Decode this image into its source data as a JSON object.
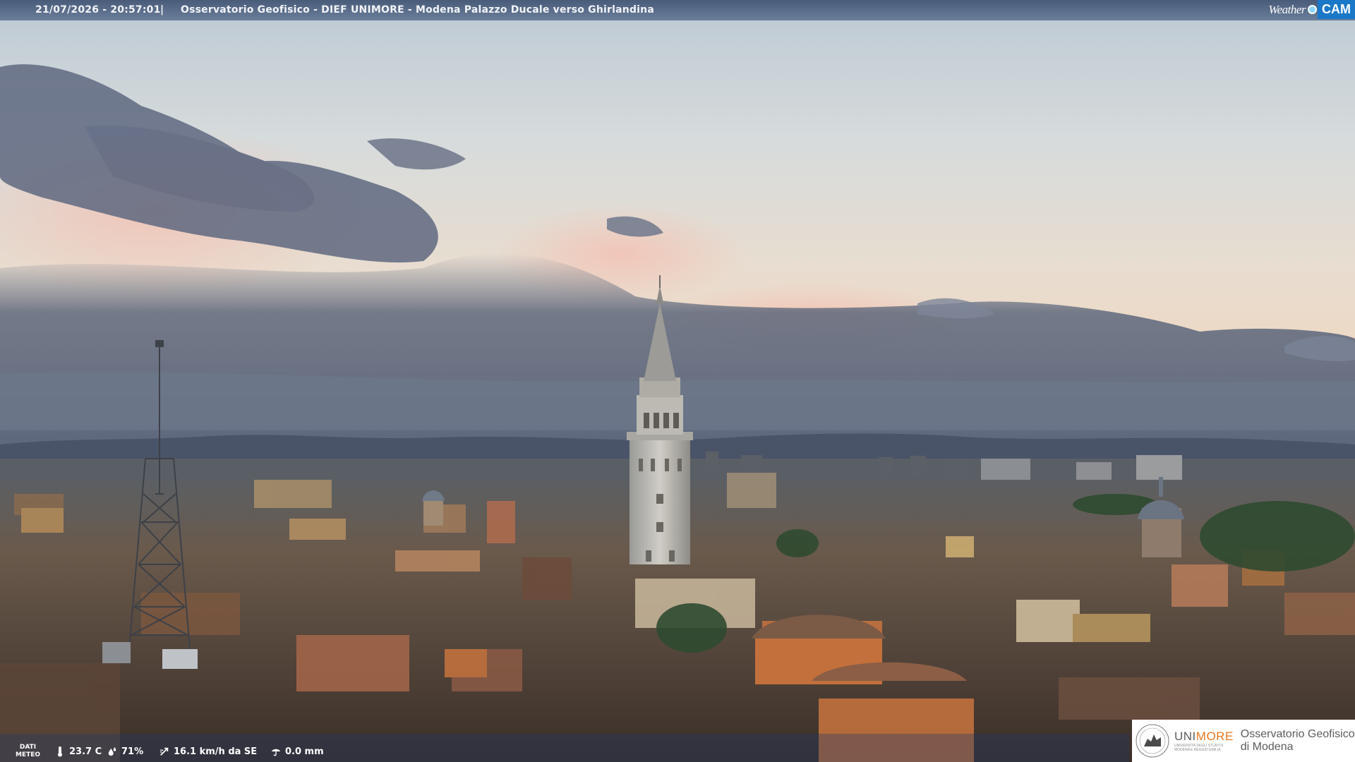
{
  "header": {
    "datetime": "21/07/2026 - 20:57:01",
    "separator": "|",
    "caption": "Osservatorio Geofisico - DIEF UNIMORE - Modena Palazzo Ducale verso Ghirlandina"
  },
  "brand": {
    "weather": "Weather",
    "cam": "CAM",
    "accent_color": "#1b78c8"
  },
  "meteo": {
    "label_line1": "DATI",
    "label_line2": "METEO",
    "temperature": "23.7 C",
    "humidity": "71%",
    "wind": "16.1 km/h da SE",
    "rain": "0.0 mm",
    "icons": [
      "thermometer-icon",
      "humidity-drops-icon",
      "wind-icon",
      "rain-icon"
    ]
  },
  "logo": {
    "name_uni": "UNI",
    "name_more": "MORE",
    "sub_line1": "UNIVERSITÀ DEGLI STUDI DI",
    "sub_line2": "MODENA E REGGIO EMILIA",
    "observatory_line1": "Osservatorio Geofisico",
    "observatory_line2": "di Modena"
  }
}
